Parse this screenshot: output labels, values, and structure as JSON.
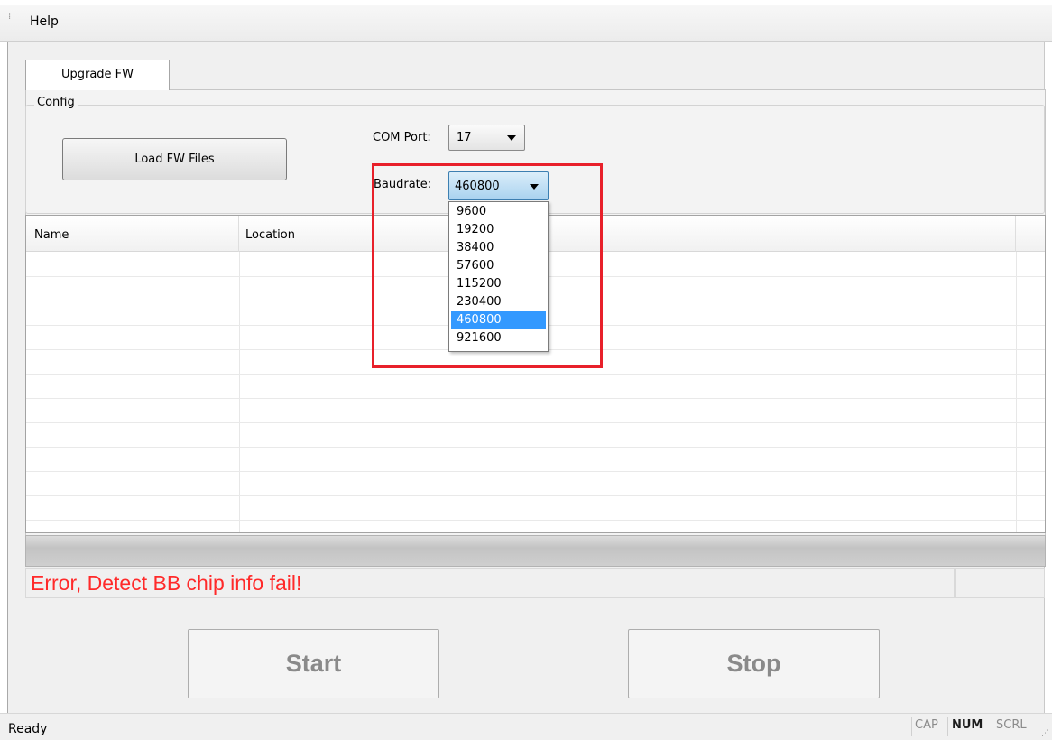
{
  "menu": {
    "help_label": "Help"
  },
  "tabs": [
    {
      "label": "Upgrade FW",
      "active": true
    }
  ],
  "config": {
    "group_label": "Config",
    "load_button_label": "Load FW Files",
    "com_port": {
      "label": "COM Port:",
      "value": "17"
    },
    "baudrate": {
      "label": "Baudrate:",
      "value": "460800",
      "options": [
        "9600",
        "19200",
        "38400",
        "57600",
        "115200",
        "230400",
        "460800",
        "921600"
      ],
      "selected_index": 6,
      "dropdown_open": true
    }
  },
  "file_list": {
    "columns": [
      "Name",
      "Location"
    ],
    "rows": []
  },
  "progress": {
    "value_fraction": 0
  },
  "status": {
    "message": "Error, Detect BB chip info fail!",
    "message_color": "#ff2a2a"
  },
  "actions": {
    "start_label": "Start",
    "stop_label": "Stop"
  },
  "statusbar": {
    "ready": "Ready",
    "cap": "CAP",
    "num": "NUM",
    "scrl": "SCRL"
  },
  "annotation": {
    "highlight_color": "#e8202a"
  },
  "colors": {
    "selection": "#3399ff",
    "frame_bg": "#f0f0f0"
  }
}
